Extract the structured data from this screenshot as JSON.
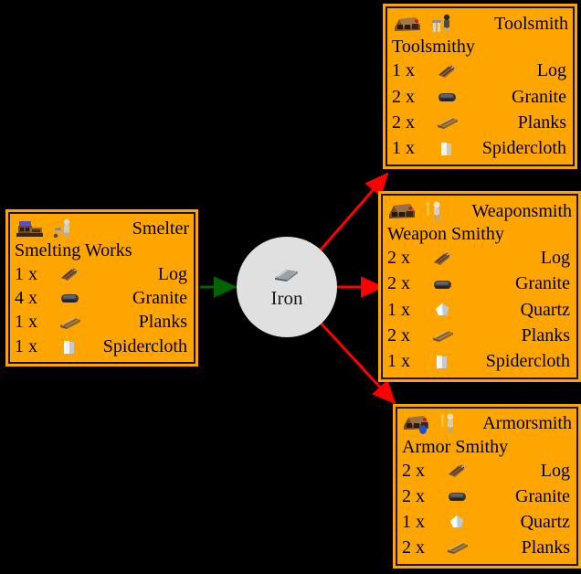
{
  "graph": {
    "background_color": "#000000",
    "box_fill_color": "#FFA500",
    "box_border_color": "#1a1208",
    "circle_fill_color": "#e0e0e0",
    "input_edge_color": "#006400",
    "output_edge_color": "#ff0000"
  },
  "resource_node": {
    "label": "Iron",
    "icon": "iron-bar-icon"
  },
  "nodes": [
    {
      "id": "smelter",
      "title": "Smelter",
      "subtitle": "Smelting Works",
      "icons": [
        "smelter-building-icon",
        "smelter-worker-icon"
      ],
      "requirements": [
        {
          "count": "1 x",
          "icon": "log-icon",
          "label": "Log"
        },
        {
          "count": "4 x",
          "icon": "granite-icon",
          "label": "Granite"
        },
        {
          "count": "1 x",
          "icon": "planks-icon",
          "label": "Planks"
        },
        {
          "count": "1 x",
          "icon": "spidercloth-icon",
          "label": "Spidercloth"
        }
      ]
    },
    {
      "id": "toolsmith",
      "title": "Toolsmith",
      "subtitle": "Toolsmithy",
      "icons": [
        "toolsmith-building-icon",
        "toolsmith-worker-icon"
      ],
      "requirements": [
        {
          "count": "1 x",
          "icon": "log-icon",
          "label": "Log"
        },
        {
          "count": "2 x",
          "icon": "granite-icon",
          "label": "Granite"
        },
        {
          "count": "2 x",
          "icon": "planks-icon",
          "label": "Planks"
        },
        {
          "count": "1 x",
          "icon": "spidercloth-icon",
          "label": "Spidercloth"
        }
      ]
    },
    {
      "id": "weaponsmith",
      "title": "Weaponsmith",
      "subtitle": "Weapon Smithy",
      "icons": [
        "weaponsmith-building-icon",
        "weaponsmith-worker-icon"
      ],
      "requirements": [
        {
          "count": "2 x",
          "icon": "log-icon",
          "label": "Log"
        },
        {
          "count": "2 x",
          "icon": "granite-icon",
          "label": "Granite"
        },
        {
          "count": "1 x",
          "icon": "quartz-icon",
          "label": "Quartz"
        },
        {
          "count": "2 x",
          "icon": "planks-icon",
          "label": "Planks"
        },
        {
          "count": "1 x",
          "icon": "spidercloth-icon",
          "label": "Spidercloth"
        }
      ]
    },
    {
      "id": "armorsmith",
      "title": "Armorsmith",
      "subtitle": "Armor Smithy",
      "icons": [
        "armorsmith-building-icon",
        "armorsmith-worker-icon"
      ],
      "requirements": [
        {
          "count": "2 x",
          "icon": "log-icon",
          "label": "Log"
        },
        {
          "count": "2 x",
          "icon": "granite-icon",
          "label": "Granite"
        },
        {
          "count": "1 x",
          "icon": "quartz-icon",
          "label": "Quartz"
        },
        {
          "count": "2 x",
          "icon": "planks-icon",
          "label": "Planks"
        }
      ]
    }
  ]
}
